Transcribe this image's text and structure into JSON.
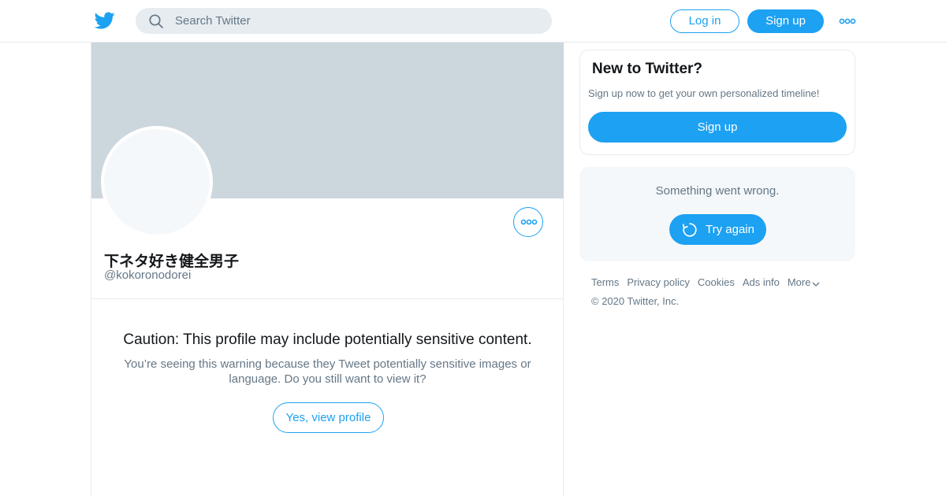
{
  "header": {
    "logo_icon": "twitter-bird-icon",
    "search_placeholder": "Search Twitter",
    "login_label": "Log in",
    "signup_label": "Sign up",
    "more_icon": "more-icon"
  },
  "profile": {
    "display_name": "下ネタ好き健全男子",
    "handle": "@kokoronodorei",
    "caution_title": "Caution: This profile may include potentially sensitive content.",
    "caution_body": "You’re seeing this warning because they Tweet potentially sensitive images or language. Do you still want to view it?",
    "view_button": "Yes, view profile"
  },
  "sidebar": {
    "new_title": "New to Twitter?",
    "new_sub": "Sign up now to get your own personalized timeline!",
    "new_button": "Sign up",
    "error_message": "Something went wrong.",
    "retry_button": "Try again",
    "footer_links": [
      "Terms",
      "Privacy policy",
      "Cookies",
      "Ads info",
      "More"
    ],
    "copyright": "© 2020 Twitter, Inc."
  },
  "colors": {
    "accent": "#1da1f2",
    "banner": "#ccd6dd",
    "muted_text": "#657786",
    "border": "#e6ecf0"
  }
}
